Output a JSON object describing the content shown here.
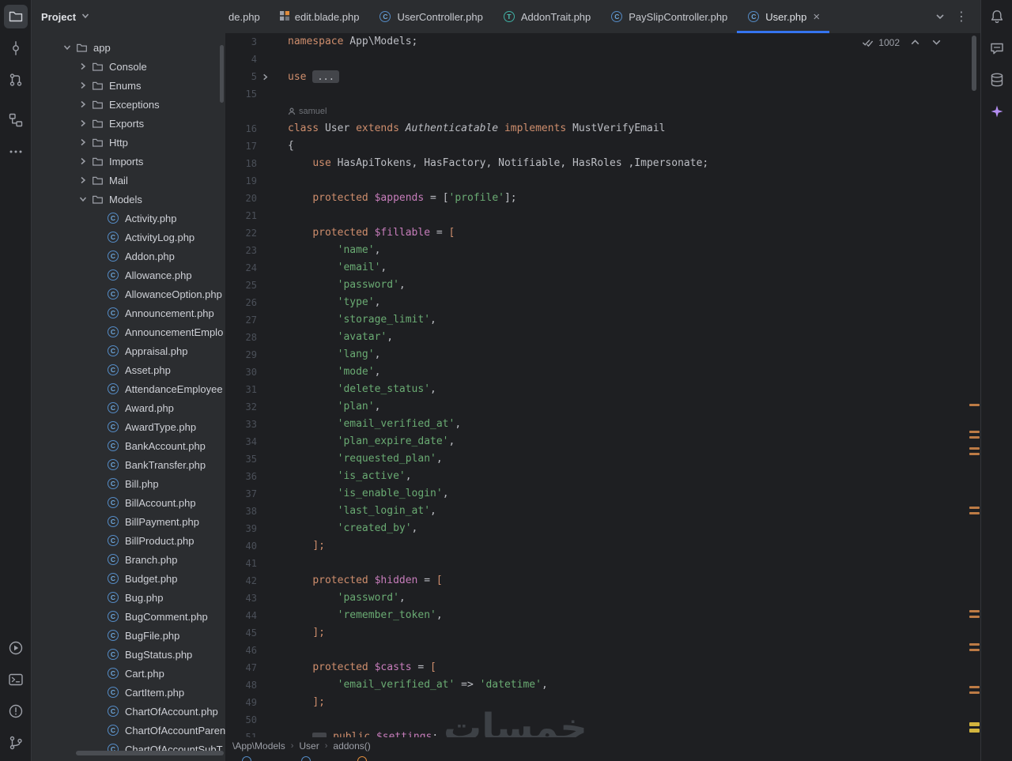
{
  "colors": {
    "accent": "#3574f0",
    "keyword": "#cf8e6d",
    "string": "#6aab73",
    "field": "#c77dbb",
    "stripe_orange": "#bd7b45",
    "stripe_yellow": "#d3b53e",
    "icon_blue": "#548bc5",
    "icon_orange": "#e08c3c"
  },
  "toolbars": {
    "left_top": [
      {
        "name": "project",
        "active": true
      },
      {
        "name": "commit"
      },
      {
        "name": "pull-requests"
      },
      {
        "name": "structure",
        "gap": true
      },
      {
        "name": "more"
      }
    ],
    "left_bottom": [
      {
        "name": "run"
      },
      {
        "name": "terminal"
      },
      {
        "name": "problems"
      },
      {
        "name": "git-branch"
      }
    ],
    "right": [
      {
        "name": "notifications"
      },
      {
        "name": "ai-chat"
      },
      {
        "name": "database"
      },
      {
        "name": "ai-assistant"
      }
    ]
  },
  "projectPanel": {
    "title": "Project",
    "tree": [
      {
        "kind": "folder",
        "label": "app",
        "depth": 0,
        "state": "expanded"
      },
      {
        "kind": "folder",
        "label": "Console",
        "depth": 1,
        "state": "collapsed"
      },
      {
        "kind": "folder",
        "label": "Enums",
        "depth": 1,
        "state": "collapsed"
      },
      {
        "kind": "folder",
        "label": "Exceptions",
        "depth": 1,
        "state": "collapsed"
      },
      {
        "kind": "folder",
        "label": "Exports",
        "depth": 1,
        "state": "collapsed"
      },
      {
        "kind": "folder",
        "label": "Http",
        "depth": 1,
        "state": "collapsed"
      },
      {
        "kind": "folder",
        "label": "Imports",
        "depth": 1,
        "state": "collapsed"
      },
      {
        "kind": "folder",
        "label": "Mail",
        "depth": 1,
        "state": "collapsed"
      },
      {
        "kind": "folder",
        "label": "Models",
        "depth": 1,
        "state": "expanded"
      },
      {
        "kind": "file",
        "label": "Activity.php",
        "depth": 2
      },
      {
        "kind": "file",
        "label": "ActivityLog.php",
        "depth": 2
      },
      {
        "kind": "file",
        "label": "Addon.php",
        "depth": 2
      },
      {
        "kind": "file",
        "label": "Allowance.php",
        "depth": 2
      },
      {
        "kind": "file",
        "label": "AllowanceOption.php",
        "depth": 2
      },
      {
        "kind": "file",
        "label": "Announcement.php",
        "depth": 2
      },
      {
        "kind": "file",
        "label": "AnnouncementEmplo",
        "depth": 2
      },
      {
        "kind": "file",
        "label": "Appraisal.php",
        "depth": 2
      },
      {
        "kind": "file",
        "label": "Asset.php",
        "depth": 2
      },
      {
        "kind": "file",
        "label": "AttendanceEmployee",
        "depth": 2
      },
      {
        "kind": "file",
        "label": "Award.php",
        "depth": 2
      },
      {
        "kind": "file",
        "label": "AwardType.php",
        "depth": 2
      },
      {
        "kind": "file",
        "label": "BankAccount.php",
        "depth": 2
      },
      {
        "kind": "file",
        "label": "BankTransfer.php",
        "depth": 2
      },
      {
        "kind": "file",
        "label": "Bill.php",
        "depth": 2
      },
      {
        "kind": "file",
        "label": "BillAccount.php",
        "depth": 2
      },
      {
        "kind": "file",
        "label": "BillPayment.php",
        "depth": 2
      },
      {
        "kind": "file",
        "label": "BillProduct.php",
        "depth": 2
      },
      {
        "kind": "file",
        "label": "Branch.php",
        "depth": 2
      },
      {
        "kind": "file",
        "label": "Budget.php",
        "depth": 2
      },
      {
        "kind": "file",
        "label": "Bug.php",
        "depth": 2
      },
      {
        "kind": "file",
        "label": "BugComment.php",
        "depth": 2
      },
      {
        "kind": "file",
        "label": "BugFile.php",
        "depth": 2
      },
      {
        "kind": "file",
        "label": "BugStatus.php",
        "depth": 2
      },
      {
        "kind": "file",
        "label": "Cart.php",
        "depth": 2
      },
      {
        "kind": "file",
        "label": "CartItem.php",
        "depth": 2
      },
      {
        "kind": "file",
        "label": "ChartOfAccount.php",
        "depth": 2
      },
      {
        "kind": "file",
        "label": "ChartOfAccountParen",
        "depth": 2
      },
      {
        "kind": "file",
        "label": "ChartOfAccountSubT",
        "depth": 2
      }
    ]
  },
  "tabs": {
    "items": [
      {
        "label": "de.php",
        "icon": "none",
        "clipped": true
      },
      {
        "label": "edit.blade.php",
        "icon": "blade"
      },
      {
        "label": "UserController.php",
        "icon": "class"
      },
      {
        "label": "AddonTrait.php",
        "icon": "trait"
      },
      {
        "label": "PaySlipController.php",
        "icon": "class"
      },
      {
        "label": "User.php",
        "icon": "class",
        "active": true,
        "close": true
      }
    ]
  },
  "editor": {
    "inspections": {
      "count": "1002"
    },
    "lines": [
      {
        "n": "3",
        "t": [
          [
            "k",
            "namespace"
          ],
          [
            "p",
            " App\\Models;"
          ]
        ]
      },
      {
        "n": "4",
        "t": []
      },
      {
        "n": "5",
        "fold": true,
        "t": [
          [
            "k",
            "use"
          ],
          [
            "p",
            " "
          ],
          [
            "fd",
            "..."
          ]
        ]
      },
      {
        "n": "15",
        "t": []
      },
      {
        "author": "samuel"
      },
      {
        "n": "16",
        "t": [
          [
            "k",
            "class"
          ],
          [
            "p",
            " User "
          ],
          [
            "k",
            "extends"
          ],
          [
            "i",
            " Authenticatable "
          ],
          [
            "k",
            "implements"
          ],
          [
            "p",
            " MustVerifyEmail"
          ]
        ]
      },
      {
        "n": "17",
        "t": [
          [
            "p",
            "{"
          ]
        ]
      },
      {
        "n": "18",
        "t": [
          [
            "p",
            "    "
          ],
          [
            "k",
            "use"
          ],
          [
            "p",
            " HasApiTokens, HasFactory, Notifiable, HasRoles ,Impersonate;"
          ]
        ]
      },
      {
        "n": "19",
        "t": []
      },
      {
        "n": "20",
        "t": [
          [
            "p",
            "    "
          ],
          [
            "k",
            "protected"
          ],
          [
            "f",
            " $appends"
          ],
          [
            "p",
            " = ["
          ],
          [
            "s",
            "'profile'"
          ],
          [
            "p",
            "];"
          ]
        ]
      },
      {
        "n": "21",
        "t": []
      },
      {
        "n": "22",
        "t": [
          [
            "p",
            "    "
          ],
          [
            "k",
            "protected"
          ],
          [
            "f",
            " $fillable"
          ],
          [
            "p",
            " = "
          ],
          [
            "k",
            "["
          ]
        ]
      },
      {
        "n": "23",
        "t": [
          [
            "p",
            "        "
          ],
          [
            "s",
            "'name'"
          ],
          [
            "p",
            ","
          ]
        ]
      },
      {
        "n": "24",
        "t": [
          [
            "p",
            "        "
          ],
          [
            "s",
            "'email'"
          ],
          [
            "p",
            ","
          ]
        ]
      },
      {
        "n": "25",
        "t": [
          [
            "p",
            "        "
          ],
          [
            "s",
            "'password'"
          ],
          [
            "p",
            ","
          ]
        ]
      },
      {
        "n": "26",
        "t": [
          [
            "p",
            "        "
          ],
          [
            "s",
            "'type'"
          ],
          [
            "p",
            ","
          ]
        ]
      },
      {
        "n": "27",
        "t": [
          [
            "p",
            "        "
          ],
          [
            "s",
            "'storage_limit'"
          ],
          [
            "p",
            ","
          ]
        ]
      },
      {
        "n": "28",
        "t": [
          [
            "p",
            "        "
          ],
          [
            "s",
            "'avatar'"
          ],
          [
            "p",
            ","
          ]
        ]
      },
      {
        "n": "29",
        "t": [
          [
            "p",
            "        "
          ],
          [
            "s",
            "'lang'"
          ],
          [
            "p",
            ","
          ]
        ]
      },
      {
        "n": "30",
        "t": [
          [
            "p",
            "        "
          ],
          [
            "s",
            "'mode'"
          ],
          [
            "p",
            ","
          ]
        ]
      },
      {
        "n": "31",
        "t": [
          [
            "p",
            "        "
          ],
          [
            "s",
            "'delete_status'"
          ],
          [
            "p",
            ","
          ]
        ]
      },
      {
        "n": "32",
        "t": [
          [
            "p",
            "        "
          ],
          [
            "s",
            "'plan'"
          ],
          [
            "p",
            ","
          ]
        ]
      },
      {
        "n": "33",
        "t": [
          [
            "p",
            "        "
          ],
          [
            "s",
            "'email_verified_at'"
          ],
          [
            "p",
            ","
          ]
        ]
      },
      {
        "n": "34",
        "t": [
          [
            "p",
            "        "
          ],
          [
            "s",
            "'plan_expire_date'"
          ],
          [
            "p",
            ","
          ]
        ]
      },
      {
        "n": "35",
        "t": [
          [
            "p",
            "        "
          ],
          [
            "s",
            "'requested_plan'"
          ],
          [
            "p",
            ","
          ]
        ]
      },
      {
        "n": "36",
        "t": [
          [
            "p",
            "        "
          ],
          [
            "s",
            "'is_active'"
          ],
          [
            "p",
            ","
          ]
        ]
      },
      {
        "n": "37",
        "t": [
          [
            "p",
            "        "
          ],
          [
            "s",
            "'is_enable_login'"
          ],
          [
            "p",
            ","
          ]
        ]
      },
      {
        "n": "38",
        "t": [
          [
            "p",
            "        "
          ],
          [
            "s",
            "'last_login_at'"
          ],
          [
            "p",
            ","
          ]
        ]
      },
      {
        "n": "39",
        "t": [
          [
            "p",
            "        "
          ],
          [
            "s",
            "'created_by'"
          ],
          [
            "p",
            ","
          ]
        ]
      },
      {
        "n": "40",
        "t": [
          [
            "p",
            "    "
          ],
          [
            "k",
            "];"
          ]
        ]
      },
      {
        "n": "41",
        "t": []
      },
      {
        "n": "42",
        "t": [
          [
            "p",
            "    "
          ],
          [
            "k",
            "protected"
          ],
          [
            "f",
            " $hidden"
          ],
          [
            "p",
            " = "
          ],
          [
            "k",
            "["
          ]
        ]
      },
      {
        "n": "43",
        "t": [
          [
            "p",
            "        "
          ],
          [
            "s",
            "'password'"
          ],
          [
            "p",
            ","
          ]
        ]
      },
      {
        "n": "44",
        "t": [
          [
            "p",
            "        "
          ],
          [
            "s",
            "'remember_token'"
          ],
          [
            "p",
            ","
          ]
        ]
      },
      {
        "n": "45",
        "t": [
          [
            "p",
            "    "
          ],
          [
            "k",
            "];"
          ]
        ]
      },
      {
        "n": "46",
        "t": []
      },
      {
        "n": "47",
        "t": [
          [
            "p",
            "    "
          ],
          [
            "k",
            "protected"
          ],
          [
            "f",
            " $casts"
          ],
          [
            "p",
            " = "
          ],
          [
            "k",
            "["
          ]
        ]
      },
      {
        "n": "48",
        "t": [
          [
            "p",
            "        "
          ],
          [
            "s",
            "'email_verified_at'"
          ],
          [
            "p",
            " => "
          ],
          [
            "s",
            "'datetime'"
          ],
          [
            "p",
            ","
          ]
        ]
      },
      {
        "n": "49",
        "t": [
          [
            "p",
            "    "
          ],
          [
            "k",
            "];"
          ]
        ]
      },
      {
        "n": "50",
        "t": []
      },
      {
        "n": "51",
        "t": [
          [
            "p",
            "    "
          ],
          [
            "bx",
            ""
          ],
          [
            "p",
            " "
          ],
          [
            "k",
            "public"
          ],
          [
            "f",
            " $settings"
          ],
          [
            "p",
            ";"
          ]
        ]
      }
    ],
    "stripe_marks": [
      {
        "t": 469,
        "c": "o"
      },
      {
        "t": 503,
        "c": "o"
      },
      {
        "t": 510,
        "c": "o"
      },
      {
        "t": 524,
        "c": "o"
      },
      {
        "t": 531,
        "c": "o"
      },
      {
        "t": 599,
        "c": "o"
      },
      {
        "t": 606,
        "c": "o"
      },
      {
        "t": 730,
        "c": "o"
      },
      {
        "t": 737,
        "c": "o"
      },
      {
        "t": 772,
        "c": "o"
      },
      {
        "t": 779,
        "c": "o"
      },
      {
        "t": 826,
        "c": "o"
      },
      {
        "t": 833,
        "c": "o"
      },
      {
        "t": 872,
        "c": "y"
      },
      {
        "t": 880,
        "c": "y"
      }
    ]
  },
  "breadcrumbs": {
    "items": [
      "\\App\\Models",
      "User",
      "addons()"
    ]
  },
  "footer": {
    "icons": [
      {
        "color": "#548bc5"
      },
      {
        "color": "#548bc5"
      },
      {
        "color": "#e08c3c"
      }
    ]
  },
  "watermark": "خمسات"
}
